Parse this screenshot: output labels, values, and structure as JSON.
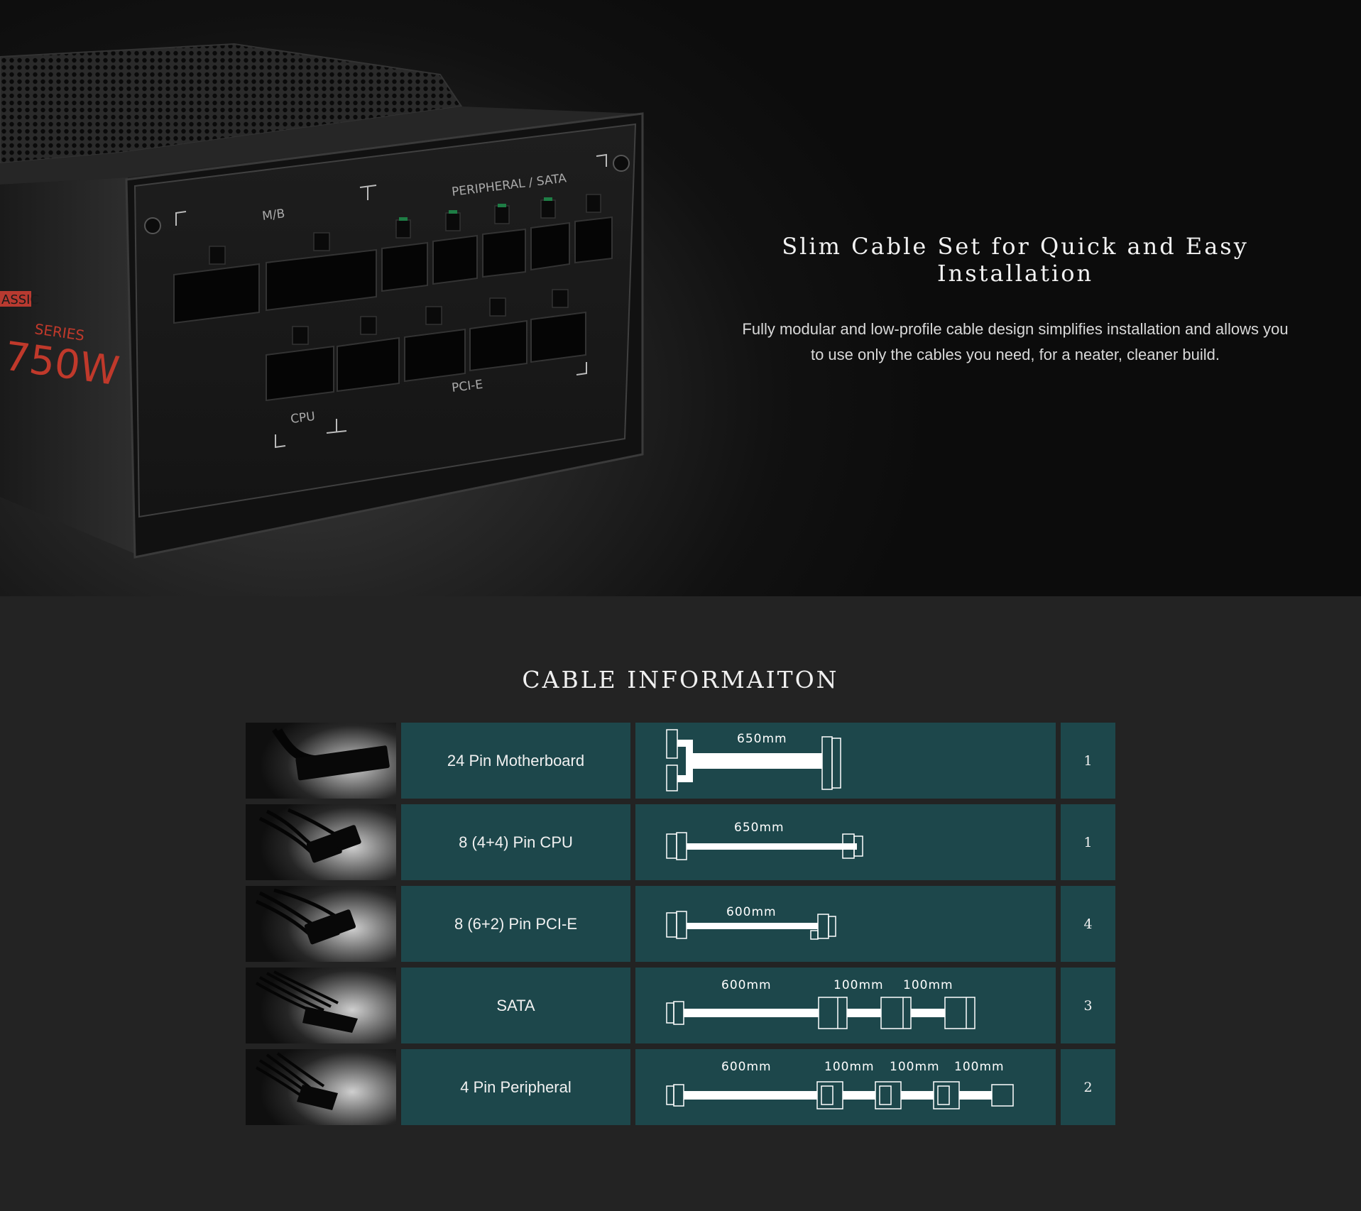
{
  "hero": {
    "title": "Slim Cable Set for Quick and Easy Installation",
    "description_line1": "Fully modular and low-profile cable design simplifies installation and allows you",
    "description_line2": "to use only the cables you need, for a neater, cleaner build.",
    "product": {
      "series_badge": "ASSIC",
      "series_label": "SERIES",
      "wattage": "750W",
      "port_labels": {
        "mb": "M/B",
        "peripheral_sata": "PERIPHERAL / SATA",
        "cpu": "CPU",
        "pcie": "PCI-E"
      }
    }
  },
  "cable_section": {
    "title": "CABLE INFORMAITON",
    "rows": [
      {
        "name": "24 Pin Motherboard",
        "lengths": [
          "650mm"
        ],
        "quantity": "1"
      },
      {
        "name": "8 (4+4) Pin CPU",
        "lengths": [
          "650mm"
        ],
        "quantity": "1"
      },
      {
        "name": "8 (6+2) Pin PCI-E",
        "lengths": [
          "600mm"
        ],
        "quantity": "4"
      },
      {
        "name": "SATA",
        "lengths": [
          "600mm",
          "100mm",
          "100mm"
        ],
        "quantity": "3"
      },
      {
        "name": "4 Pin Peripheral",
        "lengths": [
          "600mm",
          "100mm",
          "100mm",
          "100mm"
        ],
        "quantity": "2"
      }
    ]
  },
  "colors": {
    "page_background": "#232323",
    "table_cell": "#1d474b",
    "accent_red": "#c0392b",
    "text": "#f1f1f1"
  },
  "icons": [
    "psu-product-image",
    "cable-photo",
    "cable-diagram"
  ]
}
